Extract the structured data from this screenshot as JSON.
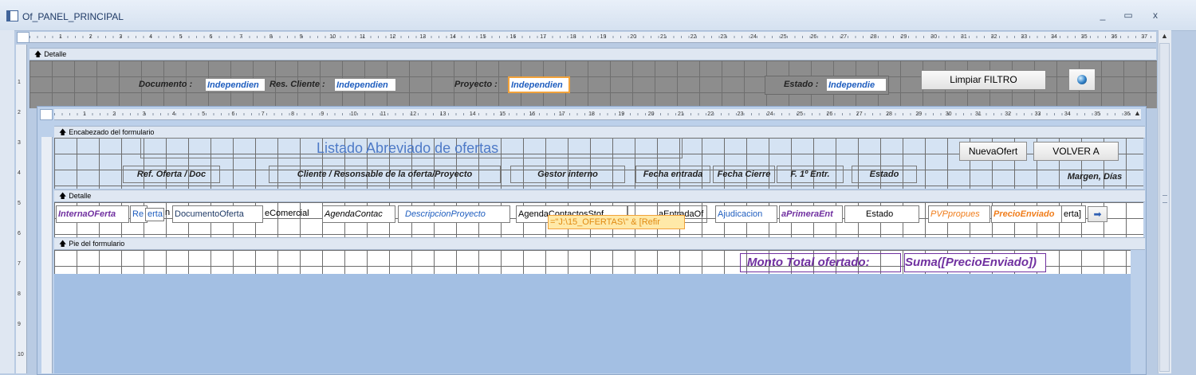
{
  "window": {
    "title": "Of_PANEL_PRINCIPAL",
    "minimize": "_",
    "maximize": "▭",
    "close": "x"
  },
  "outer_ruler": [
    "1",
    "2",
    "3",
    "4",
    "5",
    "6",
    "7",
    "8",
    "9",
    "10",
    "11",
    "12",
    "13",
    "14",
    "15",
    "16",
    "17",
    "18",
    "19",
    "20",
    "21",
    "22",
    "23",
    "24",
    "25",
    "26",
    "27",
    "28",
    "29",
    "30",
    "31",
    "32",
    "33",
    "34",
    "35",
    "36",
    "37"
  ],
  "outer_vruler": [
    "1",
    "2",
    "3",
    "4",
    "5",
    "6",
    "7",
    "8",
    "9",
    "10"
  ],
  "detalle_section": "Detalle",
  "filters": {
    "documento_label": "Documento :",
    "documento_value": "Independien",
    "res_cliente_label": "Res. Cliente :",
    "res_cliente_value": "Independien",
    "proyecto_label": "Proyecto :",
    "proyecto_value": "Independien",
    "estado_label": "Estado :",
    "estado_value": "Independie",
    "clear_button": "Limpiar FILTRO"
  },
  "subform": {
    "ruler": [
      "1",
      "2",
      "3",
      "4",
      "5",
      "6",
      "7",
      "8",
      "9",
      "10",
      "11",
      "12",
      "13",
      "14",
      "15",
      "16",
      "17",
      "18",
      "19",
      "20",
      "21",
      "22",
      "23",
      "24",
      "25",
      "26",
      "27",
      "28",
      "29",
      "30",
      "31",
      "32",
      "33",
      "34",
      "35",
      "36"
    ],
    "vruler": [
      "2",
      "3",
      "1",
      "4",
      "5",
      "6",
      "7",
      "1",
      "8",
      "2",
      "9",
      "3",
      "10",
      "4"
    ],
    "header_section": "Encabezado del formulario",
    "title": "Listado Abreviado de ofertas",
    "new_button": "NuevaOfert",
    "back_button": "VOLVER A",
    "headers": [
      "Ref. Oferta / Doc",
      "Cliente / Resonsable de la oferta/Proyecto",
      "Gestor interno",
      "Fecha entrada",
      "Fecha Cierre",
      "F. 1º Entr.",
      "Estado",
      "Margen, Días"
    ],
    "detail_section": "Detalle",
    "detail_fields": [
      "InternaOFerta",
      "Re",
      "erta",
      "n",
      "DocumentoOferta",
      "eComercial",
      "AgendaContac",
      "DescripcionProyecto",
      "AgendaContactosStof",
      "aEntradaOf",
      "Ajudicacion",
      "aPrimeraEnt",
      "Estado",
      "PVPpropues",
      "PrecioEnviado",
      "erta]"
    ],
    "overlay_field": "=\"J:\\15_OFERTAS\\\" & [Refir",
    "nav_arrow": "➡",
    "footer_section": "Pie del formulario",
    "total_label": "Monto Total ofertado:",
    "total_value": "Suma([PrecioEnviado])"
  },
  "colors": {
    "blue_text": "#1f5ebf",
    "purple_text": "#7030a0",
    "orange_text": "#f07d1b",
    "header_bg": "#d5e3f3"
  }
}
